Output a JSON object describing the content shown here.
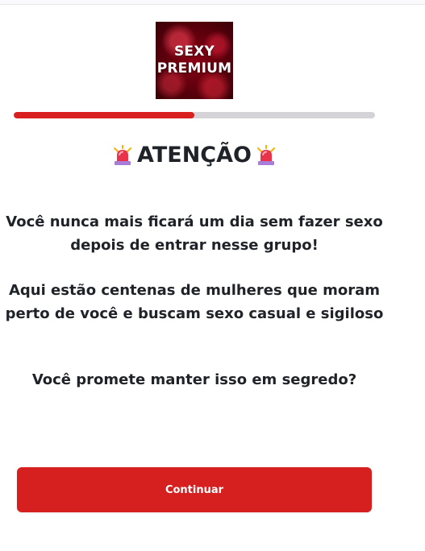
{
  "logo": {
    "line1": "SEXY",
    "line2": "PREMIUM"
  },
  "progress": {
    "value_percent": 50
  },
  "heading": {
    "text": "ATENÇÃO",
    "icon": "rotating-light-icon"
  },
  "body": {
    "paragraph1": "Você nunca mais ficará um dia sem fazer sexo depois de entrar nesse grupo!",
    "paragraph2": "Aqui estão centenas de mulheres que moram perto de você e buscam sexo casual e sigiloso",
    "paragraph3": "Você promete manter isso em segredo?"
  },
  "cta": {
    "label": "Continuar"
  },
  "colors": {
    "accent": "#d61f1f",
    "progress_track": "#d4d4d8",
    "text": "#1f2328"
  }
}
